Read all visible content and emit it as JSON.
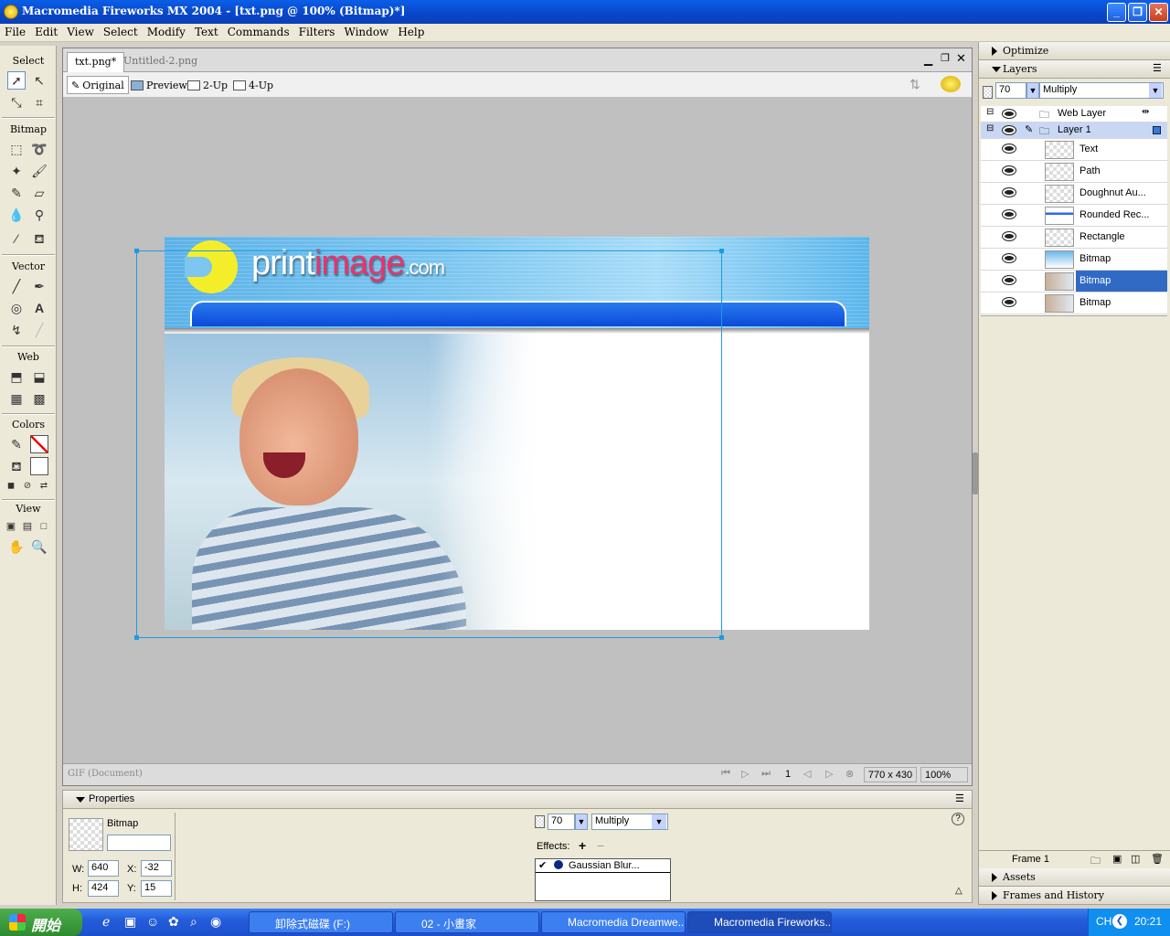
{
  "window": {
    "title": "Macromedia Fireworks MX 2004 - [txt.png @ 100% (Bitmap)*]"
  },
  "menu": [
    "File",
    "Edit",
    "View",
    "Select",
    "Modify",
    "Text",
    "Commands",
    "Filters",
    "Window",
    "Help"
  ],
  "tools": {
    "sections": {
      "select": "Select",
      "bitmap": "Bitmap",
      "vector": "Vector",
      "web": "Web",
      "colors": "Colors",
      "view": "View"
    }
  },
  "document": {
    "tabs": [
      "txt.png*",
      "Untitled-2.png"
    ],
    "views": [
      "Original",
      "Preview",
      "2-Up",
      "4-Up"
    ],
    "canvas": {
      "logo_print": "print",
      "logo_image": "image",
      "logo_com": ".com"
    },
    "status": {
      "format": "GIF (Document)",
      "frame": "1",
      "size": "770 x 430",
      "zoom": "100%"
    }
  },
  "properties": {
    "title": "Properties",
    "object_type": "Bitmap",
    "name_value": "",
    "w_label": "W:",
    "w": "640",
    "h_label": "H:",
    "h": "424",
    "x_label": "X:",
    "x": "-32",
    "y_label": "Y:",
    "y": "15",
    "opacity": "70",
    "blend": "Multiply",
    "effects_label": "Effects:",
    "effects": [
      "Gaussian Blur..."
    ]
  },
  "panels": {
    "optimize": "Optimize",
    "layers": "Layers",
    "opacity": "70",
    "blend": "Multiply",
    "web_layer": "Web Layer",
    "layer1": "Layer 1",
    "objects": [
      {
        "name": "Text",
        "selected": false
      },
      {
        "name": "Path",
        "selected": false
      },
      {
        "name": "Doughnut Au...",
        "selected": false
      },
      {
        "name": "Rounded Rec...",
        "selected": false
      },
      {
        "name": "Rectangle",
        "selected": false
      },
      {
        "name": "Bitmap",
        "selected": false
      },
      {
        "name": "Bitmap",
        "selected": true
      },
      {
        "name": "Bitmap",
        "selected": false
      }
    ],
    "frame_label": "Frame 1",
    "assets": "Assets",
    "frames_history": "Frames and History"
  },
  "taskbar": {
    "start": "開始",
    "tasks": [
      "卸除式磁碟 (F:)",
      "02 - 小畫家",
      "Macromedia Dreamwe...",
      "Macromedia Fireworks..."
    ],
    "tray_lang": "CH",
    "clock": "20:21"
  }
}
